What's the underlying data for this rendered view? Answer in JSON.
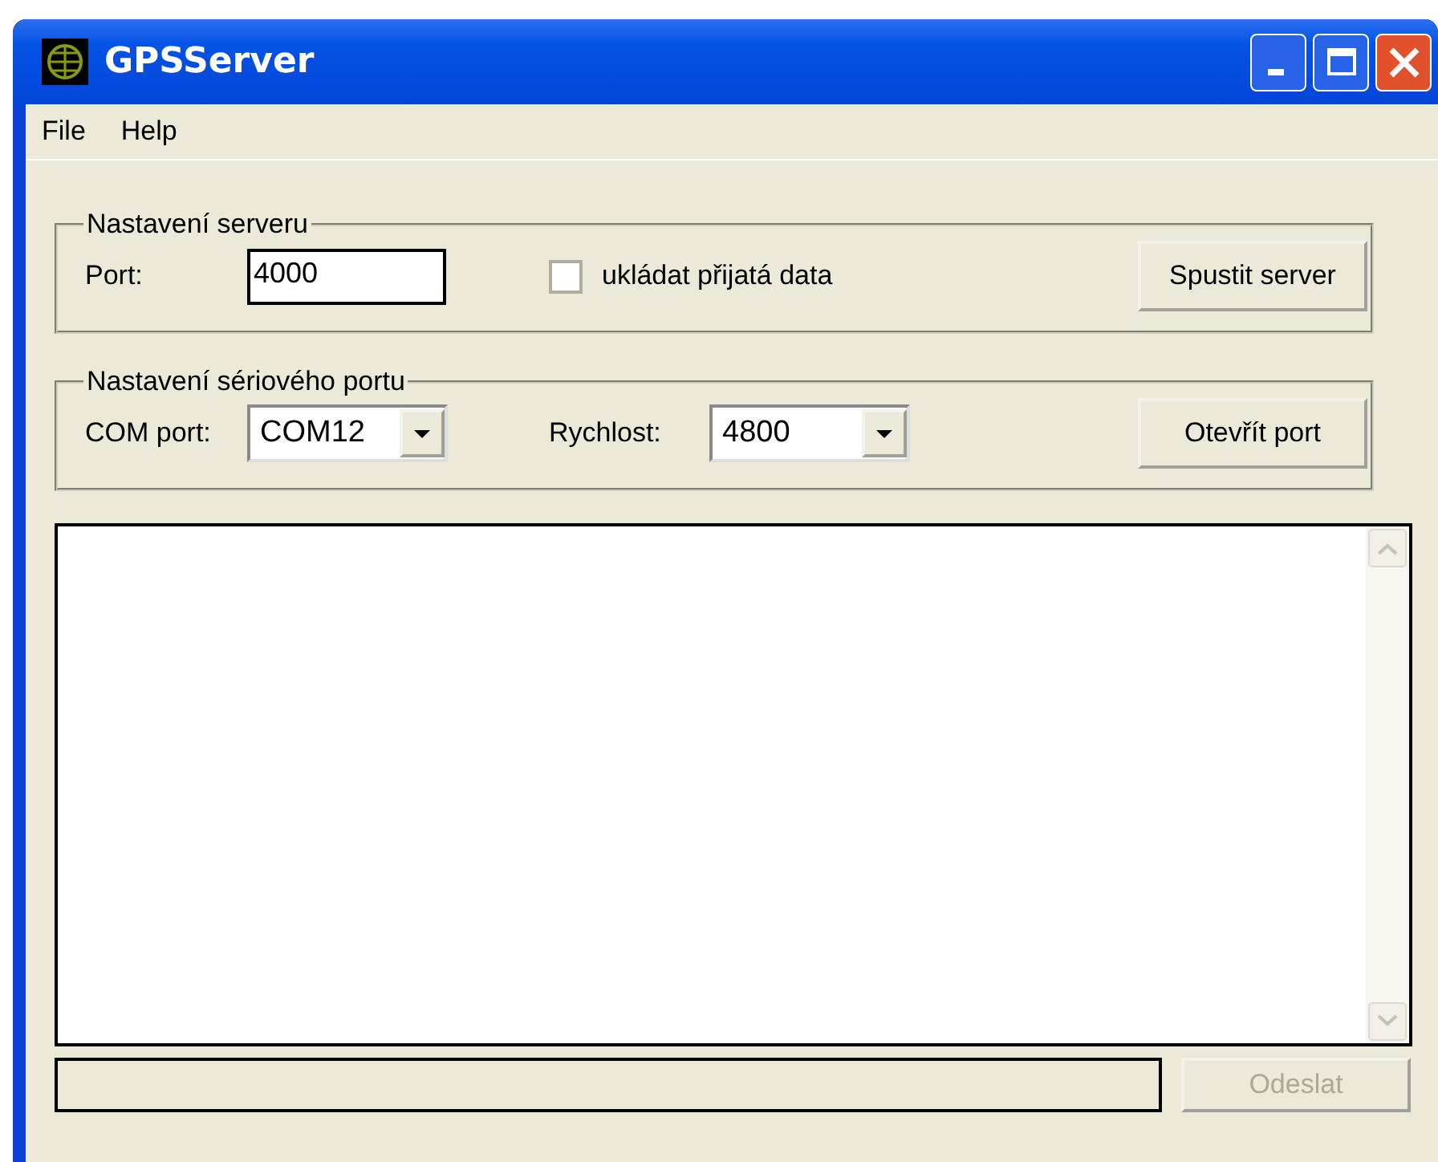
{
  "window": {
    "title": "GPSServer"
  },
  "menu": [
    {
      "label": "File"
    },
    {
      "label": "Help"
    }
  ],
  "server_group": {
    "legend": "Nastavení serveru",
    "port_label": "Port:",
    "port_value": "4000",
    "save_checkbox": {
      "label": "ukládat přijatá data",
      "checked": false
    },
    "button": {
      "label": "Spustit server",
      "disabled": false
    }
  },
  "serial_group": {
    "legend": "Nastavení sériového portu",
    "com_label": "COM port:",
    "com_value": "COM12",
    "speed_label": "Rychlost:",
    "speed_value": "4800",
    "button": {
      "label": "Otevřít port",
      "disabled": false
    }
  },
  "message_field": {
    "disabled": true
  },
  "send_button": {
    "label": "Odeslat",
    "disabled": true
  }
}
